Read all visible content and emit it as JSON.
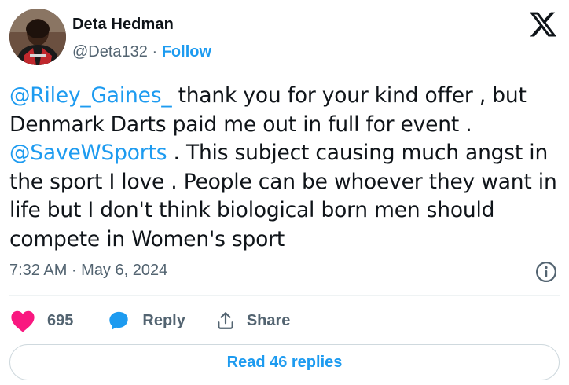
{
  "author": {
    "name": "Deta Hedman",
    "handle": "@Deta132",
    "separator": "·",
    "follow_label": "Follow"
  },
  "brand_icon": "x-logo-icon",
  "tweet": {
    "lines": [
      {
        "mention": "@Riley_Gaines_",
        "text": " thank you for your kind offer , but"
      },
      {
        "mention": "",
        "text": "Denmark Darts paid me out in full for event ."
      },
      {
        "mention": "@SaveWSports",
        "text": " . This subject causing much angst in"
      },
      {
        "mention": "",
        "text": "the sport I love . People can be whoever they want in"
      },
      {
        "mention": "",
        "text": "life but I don't think biological born men should"
      },
      {
        "mention": "",
        "text": "compete in Women's sport"
      }
    ]
  },
  "timestamp": "7:32 AM · May 6, 2024",
  "actions": {
    "like_count": "695",
    "reply_label": "Reply",
    "share_label": "Share"
  },
  "read_replies_label": "Read 46 replies",
  "colors": {
    "accent": "#1d9bf0",
    "like": "#f91880",
    "text": "#0f1419",
    "secondary": "#536471"
  }
}
